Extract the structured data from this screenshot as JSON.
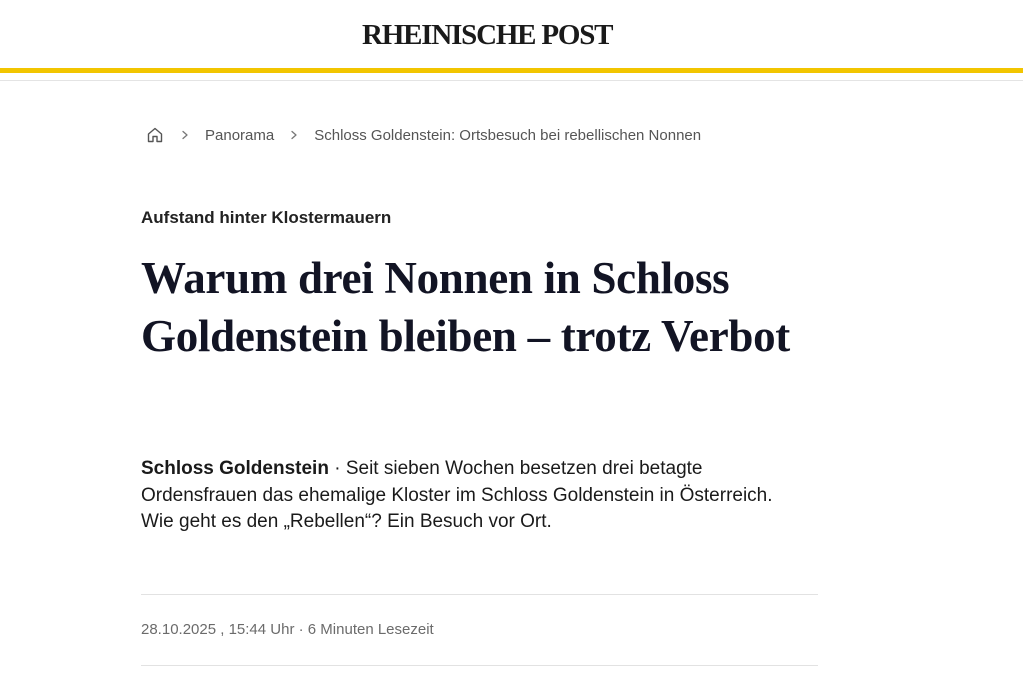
{
  "header": {
    "logo_text": "RHEINISCHE POST",
    "accent_color": "#f2c500"
  },
  "breadcrumb": {
    "home_icon": "home-icon",
    "separator_icon": "chevron-right-icon",
    "items": [
      {
        "label": "Panorama"
      },
      {
        "label": "Schloss Goldenstein: Ortsbesuch bei rebellischen Nonnen"
      }
    ]
  },
  "article": {
    "kicker": "Aufstand hinter Klostermauern",
    "headline": "Warum drei Nonnen in Schloss Goldenstein bleiben – trotz Verbot",
    "dateline": "Schloss Goldenstein",
    "dateline_separator": " · ",
    "teaser": "Seit sieben Wochen besetzen drei betagte Ordensfrauen das ehemalige Kloster im Schloss Goldenstein in Österreich. Wie geht es den „Rebellen“? Ein Besuch vor Ort.",
    "date": "28.10.2025 , 15:44 Uhr",
    "meta_separator": " · ",
    "reading_time": "6 Minuten Lesezeit"
  }
}
